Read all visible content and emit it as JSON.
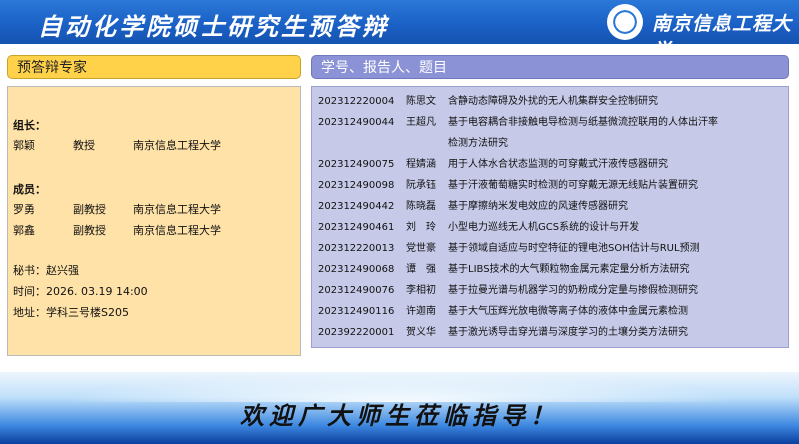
{
  "header": {
    "title": "自动化学院硕士研究生预答辩",
    "school": "南京信息工程大学"
  },
  "experts": {
    "heading": "预答辩专家",
    "leader_label": "组长：",
    "leader": {
      "name": "郭颖",
      "title": "教授",
      "org": "南京信息工程大学"
    },
    "members_label": "成员：",
    "members": [
      {
        "name": "罗勇",
        "title": "副教授",
        "org": "南京信息工程大学"
      },
      {
        "name": "郭鑫",
        "title": "副教授",
        "org": "南京信息工程大学"
      }
    ],
    "secretary": "秘书：赵兴强",
    "time": "时间：2026. 03.19  14:00",
    "place": "地址：学科三号楼S205"
  },
  "students": {
    "heading": "学号、报告人、题目",
    "rows": [
      {
        "id": "202312220004",
        "name": "陈思文",
        "topic": "含静动态障碍及外扰的无人机集群安全控制研究"
      },
      {
        "id": "202312490044",
        "name": "王超凡",
        "topic": "基于电容耦合非接触电导检测与纸基微流控联用的人体出汗率",
        "topic2": "检测方法研究"
      },
      {
        "id": "202312490075",
        "name": "程婧涵",
        "topic": "用于人体水合状态监测的可穿戴式汗液传感器研究"
      },
      {
        "id": "202312490098",
        "name": "阮承钰",
        "topic": "基于汗液葡萄糖实时检测的可穿戴无源无线贴片装置研究"
      },
      {
        "id": "202312490442",
        "name": "陈晓磊",
        "topic": "基于摩擦纳米发电效应的风速传感器研究"
      },
      {
        "id": "202312490461",
        "name": "刘　玲",
        "topic": "小型电力巡线无人机GCS系统的设计与开发"
      },
      {
        "id": "202312220013",
        "name": "党世豪",
        "topic": "基于领域自适应与时空特征的锂电池SOH估计与RUL预测"
      },
      {
        "id": "202312490068",
        "name": "谭　强",
        "topic": "基于LIBS技术的大气颗粒物金属元素定量分析方法研究"
      },
      {
        "id": "202312490076",
        "name": "李相初",
        "topic": "基于拉曼光谱与机器学习的奶粉成分定量与掺假检测研究"
      },
      {
        "id": "202312490116",
        "name": "许迦南",
        "topic": "基于大气压辉光放电微等离子体的液体中金属元素检测"
      },
      {
        "id": "202392220001",
        "name": "贺义华",
        "topic": "基于激光诱导击穿光谱与深度学习的土壤分类方法研究"
      }
    ]
  },
  "footer": {
    "welcome": "欢迎广大师生莅临指导！"
  }
}
